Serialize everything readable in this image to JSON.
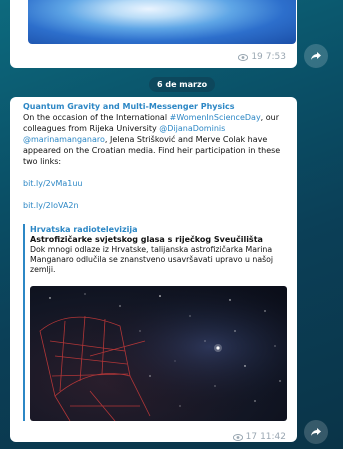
{
  "prev_message": {
    "views": "19",
    "time": "7:53"
  },
  "date_separator": "6 de marzo",
  "message": {
    "channel": "Quantum Gravity and Multi-Messenger Physics",
    "text_1": "On the occasion of the International ",
    "hashtag": "#WomenInScienceDay",
    "text_2": ", our colleagues from Rijeka University ",
    "mention_1": "@DijanaDominis",
    "mention_2": "@marinamanganaro",
    "text_3": ", Jelena Strišković and Merve Colak have appeared on the Croatian media. Find heir participation in these two links:",
    "link_1": "bit.ly/2vMa1uu",
    "link_2": "bit.ly/2IoVA2n",
    "preview": {
      "source": "Hrvatska radiotelevizija",
      "title": "Astrofizičarke svjetskog glasa s riječkog Sveučilišta",
      "description": "Dok mnogi odlaze iz Hrvatske, talijanska astrofizičarka Marina Manganaro odlučila se znanstveno usavršavati upravo u našoj zemlji."
    },
    "views": "17",
    "time": "11:42"
  },
  "colors": {
    "link": "#2c87c5",
    "meta": "#9aa7b2",
    "background": "#0b4a62"
  }
}
